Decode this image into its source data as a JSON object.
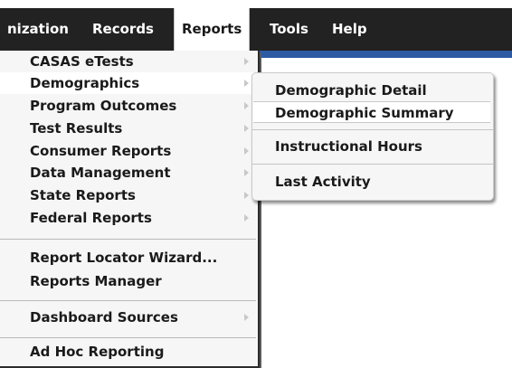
{
  "menubar": {
    "items": [
      {
        "label": "nization"
      },
      {
        "label": "Records"
      },
      {
        "label": "Reports"
      },
      {
        "label": "Tools"
      },
      {
        "label": "Help"
      }
    ],
    "active": "Reports"
  },
  "reports_menu": {
    "items": [
      {
        "label": "CASAS eTests",
        "has_submenu": true
      },
      {
        "label": "Demographics",
        "has_submenu": true
      },
      {
        "label": "Program Outcomes",
        "has_submenu": true
      },
      {
        "label": "Test Results",
        "has_submenu": true
      },
      {
        "label": "Consumer Reports",
        "has_submenu": true
      },
      {
        "label": "Data Management",
        "has_submenu": true
      },
      {
        "label": "State Reports",
        "has_submenu": true
      },
      {
        "label": "Federal Reports",
        "has_submenu": true
      },
      {
        "label": "Report Locator Wizard...",
        "has_submenu": false
      },
      {
        "label": "Reports Manager",
        "has_submenu": false
      },
      {
        "label": "Dashboard Sources",
        "has_submenu": true
      },
      {
        "label": "Ad Hoc Reporting",
        "has_submenu": false
      }
    ]
  },
  "demographics_submenu": {
    "items": [
      {
        "label": "Demographic Detail"
      },
      {
        "label": "Demographic Summary"
      },
      {
        "label": "Instructional Hours"
      },
      {
        "label": "Last Activity"
      }
    ],
    "selected": "Demographic Summary"
  },
  "colors": {
    "menubar_bg": "#222222",
    "accent_strip": "#2d5aa3",
    "menu_bg": "#f6f6f6"
  }
}
